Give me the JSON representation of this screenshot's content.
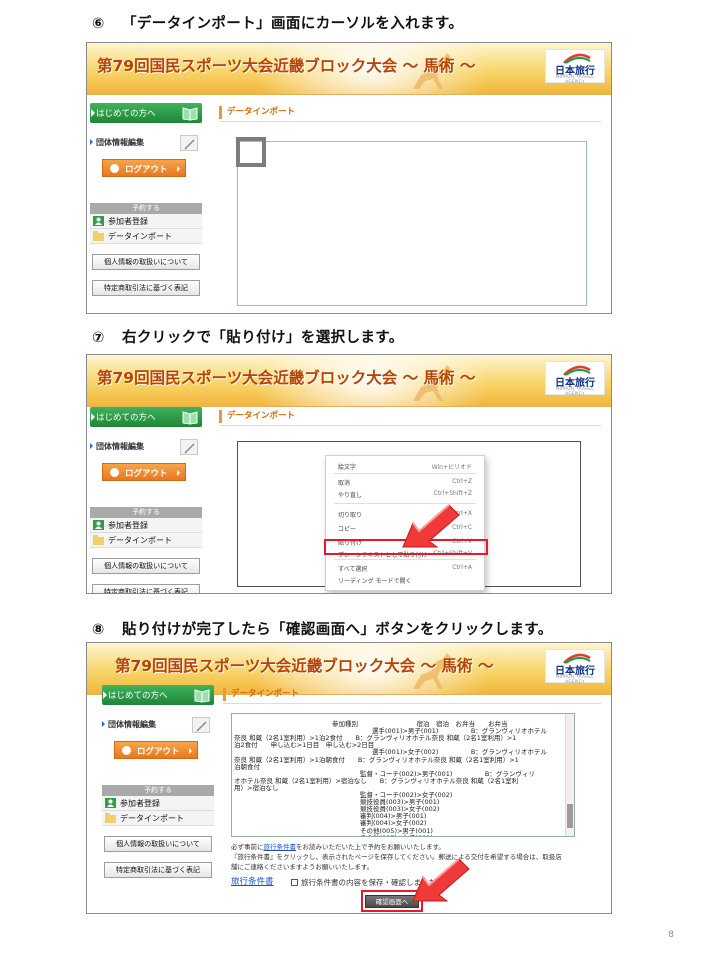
{
  "steps": [
    {
      "num": "⑥",
      "text": "「データインポート」画面にカーソルを入れます。"
    },
    {
      "num": "⑦",
      "text": "右クリックで「貼り付け」を選択します。"
    },
    {
      "num": "⑧",
      "text": "貼り付けが完了したら「確認画面へ」ボタンをクリックします。"
    }
  ],
  "banner": {
    "title": "第79回国民スポーツ大会近畿ブロック大会 ～ 馬術 ～",
    "logo_text": "日本旅行",
    "logo_sub": "NIPPON TRAVEL AGENCY"
  },
  "sidebar": {
    "first_time": "はじめての方へ",
    "dept": "団体情報編集",
    "logout": "ログアウト",
    "reserve_header": "予約する",
    "reserve_items": [
      "参加者登録",
      "データインポート"
    ],
    "privacy": "個人情報の取扱いについて",
    "tokusho": "特定商取引法に基づく表記"
  },
  "main": {
    "section_title": "データインポート"
  },
  "context_menu": [
    {
      "label": "絵文字",
      "shortcut": "Win+ピリオド"
    },
    {
      "label": "取消",
      "shortcut": "Ctrl+Z"
    },
    {
      "label": "やり直し",
      "shortcut": "Ctrl+Shift+Z"
    },
    {
      "label": "切り取り",
      "shortcut": "Ctrl+X"
    },
    {
      "label": "コピー",
      "shortcut": "Ctrl+C"
    },
    {
      "label": "貼り付け",
      "shortcut": "Ctrl+V"
    },
    {
      "label": "プレーンテキストとして貼り付け",
      "shortcut": "Ctrl+Shift+V"
    },
    {
      "label": "すべて選択",
      "shortcut": "Ctrl+A"
    },
    {
      "label": "リーディング モードで開く",
      "shortcut": ""
    }
  ],
  "pasted_lines": [
    "参加種別　　　　　　　　　宿泊　宿泊　お弁当　　お弁当",
    "選手(001)>男子(001)　　　　　B：グランヴィリオホテル",
    "奈良 和蔵（2名1室利用）>1泊2食付　　B：グランヴィリオホテル奈良 和蔵（2名1室利用）>1",
    "泊2食付　　申し込む>1日目　申し込む>2日目",
    "選手(001)>女子(002)　　　　　B：グランヴィリオホテル",
    "奈良 和蔵（2名1室利用）>1泊朝食付　　B：グランヴィリオホテル奈良 和蔵（2名1室利用）>1",
    "泊朝食付",
    "監督・コーチ(002)>男子(001)　　　　　B：グランヴィリ",
    "オホテル奈良 和蔵（2名1室利用）>宿泊なし　　B：グランヴィリオホテル奈良 和蔵（2名1室利",
    "用）>宿泊なし",
    "監督・コーチ(002)>女子(002)",
    "競技役員(003)>男子(001)",
    "競技役員(003)>女子(002)",
    "審判(004)>男子(001)",
    "審判(004)>女子(002)",
    "その他(005)>男子(001)",
    "その他(005)>女子(002)"
  ],
  "notes": {
    "line1_pre": "必ず事前に",
    "line1_link": "旅行条件書",
    "line1_post": "をお読みいただいた上で予約をお願いいたします。",
    "line2": "『旅行条件書』をクリックし、表示されたページを保存してください。郵送による交付を希望する場合は、取扱店",
    "line3": "舗にご連絡くださいますようお願いいたします。",
    "terms_link": "旅行条件書",
    "agree_text": "旅行条件書の内容を保存・確認しました",
    "confirm_button": "確認画面へ"
  },
  "page_number": "8"
}
